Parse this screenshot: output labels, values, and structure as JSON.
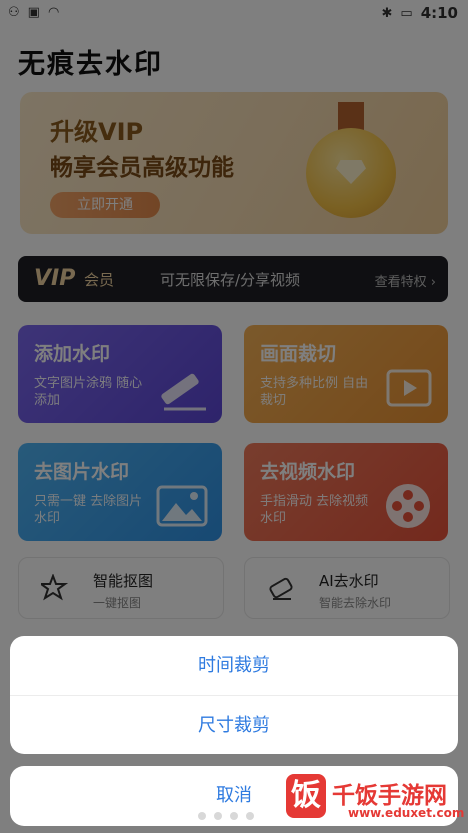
{
  "status_bar": {
    "time": "4:10"
  },
  "app": {
    "title": "无痕去水印"
  },
  "banner": {
    "line1": "升级VIP",
    "line2": "畅享会员高级功能",
    "button": "立即开通"
  },
  "vip_bar": {
    "vip": "VIP",
    "member": "会员",
    "desc": "可无限保存/分享视频",
    "link": "查看特权 ›"
  },
  "cards": [
    {
      "title": "添加水印",
      "desc": "文字图片涂鸦 随心添加",
      "icon": "pencil-icon"
    },
    {
      "title": "画面裁切",
      "desc": "支持多种比例 自由裁切",
      "icon": "video-frame-icon"
    },
    {
      "title": "去图片水印",
      "desc": "只需一键 去除图片水印",
      "icon": "image-icon"
    },
    {
      "title": "去视频水印",
      "desc": "手指滑动 去除视频水印",
      "icon": "film-reel-icon"
    }
  ],
  "tools": [
    {
      "title": "智能抠图",
      "desc": "一键抠图",
      "icon": "magic-star-icon"
    },
    {
      "title": "AI去水印",
      "desc": "智能去除水印",
      "icon": "eraser-icon"
    }
  ],
  "action_sheet": {
    "options": [
      "时间裁剪",
      "尺寸裁剪"
    ],
    "cancel": "取消"
  },
  "watermark": {
    "logo": "饭",
    "name": "千饭手游网",
    "url": "www.eduxet.com"
  },
  "colors": {
    "accent": "#2f7be0",
    "dim": "rgba(0,0,0,0.5)",
    "vip_gold": "#f1d3a0"
  }
}
